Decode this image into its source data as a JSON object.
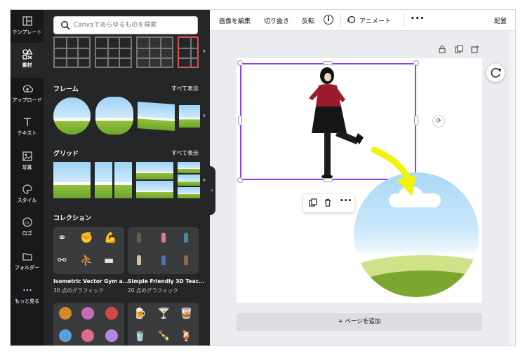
{
  "rail": {
    "items": [
      {
        "label": "テンプレート",
        "icon": "template-icon"
      },
      {
        "label": "素材",
        "icon": "elements-icon"
      },
      {
        "label": "アップロード",
        "icon": "upload-icon"
      },
      {
        "label": "テキスト",
        "icon": "text-icon"
      },
      {
        "label": "写真",
        "icon": "photo-icon"
      },
      {
        "label": "スタイル",
        "icon": "palette-icon"
      },
      {
        "label": "ロゴ",
        "icon": "logo-icon"
      },
      {
        "label": "フォルダー",
        "icon": "folder-icon"
      },
      {
        "label": "もっと見る",
        "icon": "more-icon"
      }
    ],
    "active_index": 1
  },
  "panel": {
    "search_placeholder": "Canvaであらゆるものを検索",
    "sections": {
      "frames": {
        "title": "フレーム",
        "see_all": "すべて表示"
      },
      "grids": {
        "title": "グリッド",
        "see_all": "すべて表示"
      },
      "collection": {
        "title": "コレクション"
      }
    },
    "collections": [
      {
        "title": "Isometric Vector Gym a...",
        "subtitle": "30 点のグラフィック"
      },
      {
        "title": "Simple Friendly 3D Teac...",
        "subtitle": "20 点のグラフィック"
      }
    ]
  },
  "toolbar": {
    "edit_image": "画像を編集",
    "crop": "切り抜き",
    "flip": "反転",
    "info": "i",
    "animate": "アニメート",
    "more": "•••",
    "position": "配置"
  },
  "canvas": {
    "add_page": "+ ページを追加",
    "context_more": "•••"
  },
  "colors": {
    "accent": "#8b3dff",
    "rail_bg": "#18191b",
    "panel_bg": "#252627",
    "arrow": "#f2f20c"
  }
}
